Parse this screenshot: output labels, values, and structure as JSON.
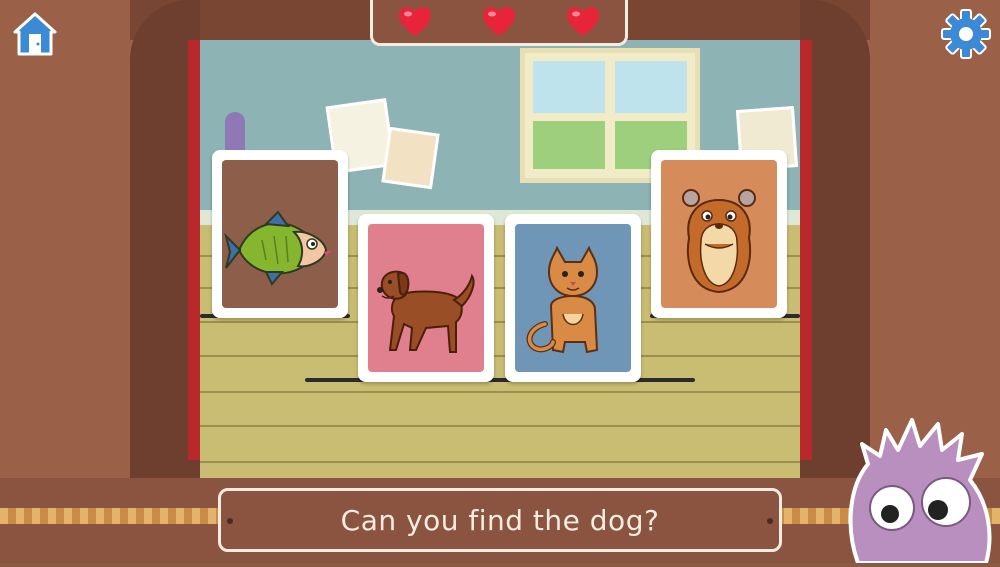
{
  "hud": {
    "lives_total": 3,
    "lives_remaining": 3,
    "heart_color": "#e8243a"
  },
  "buttons": {
    "home_icon": "house-door-icon",
    "settings_icon": "gear-icon",
    "icon_color": "#3c8ad6"
  },
  "cards": [
    {
      "animal": "fish",
      "background": "#8d5f4b"
    },
    {
      "animal": "dog",
      "background": "#e0808f"
    },
    {
      "animal": "cat",
      "background": "#6f95b7"
    },
    {
      "animal": "hamster",
      "background": "#d58b5a"
    }
  ],
  "prompt": {
    "text": "Can you find the dog?"
  },
  "mascot": {
    "name": "purple-fuzzy-monster",
    "color": "#b98fbf"
  }
}
